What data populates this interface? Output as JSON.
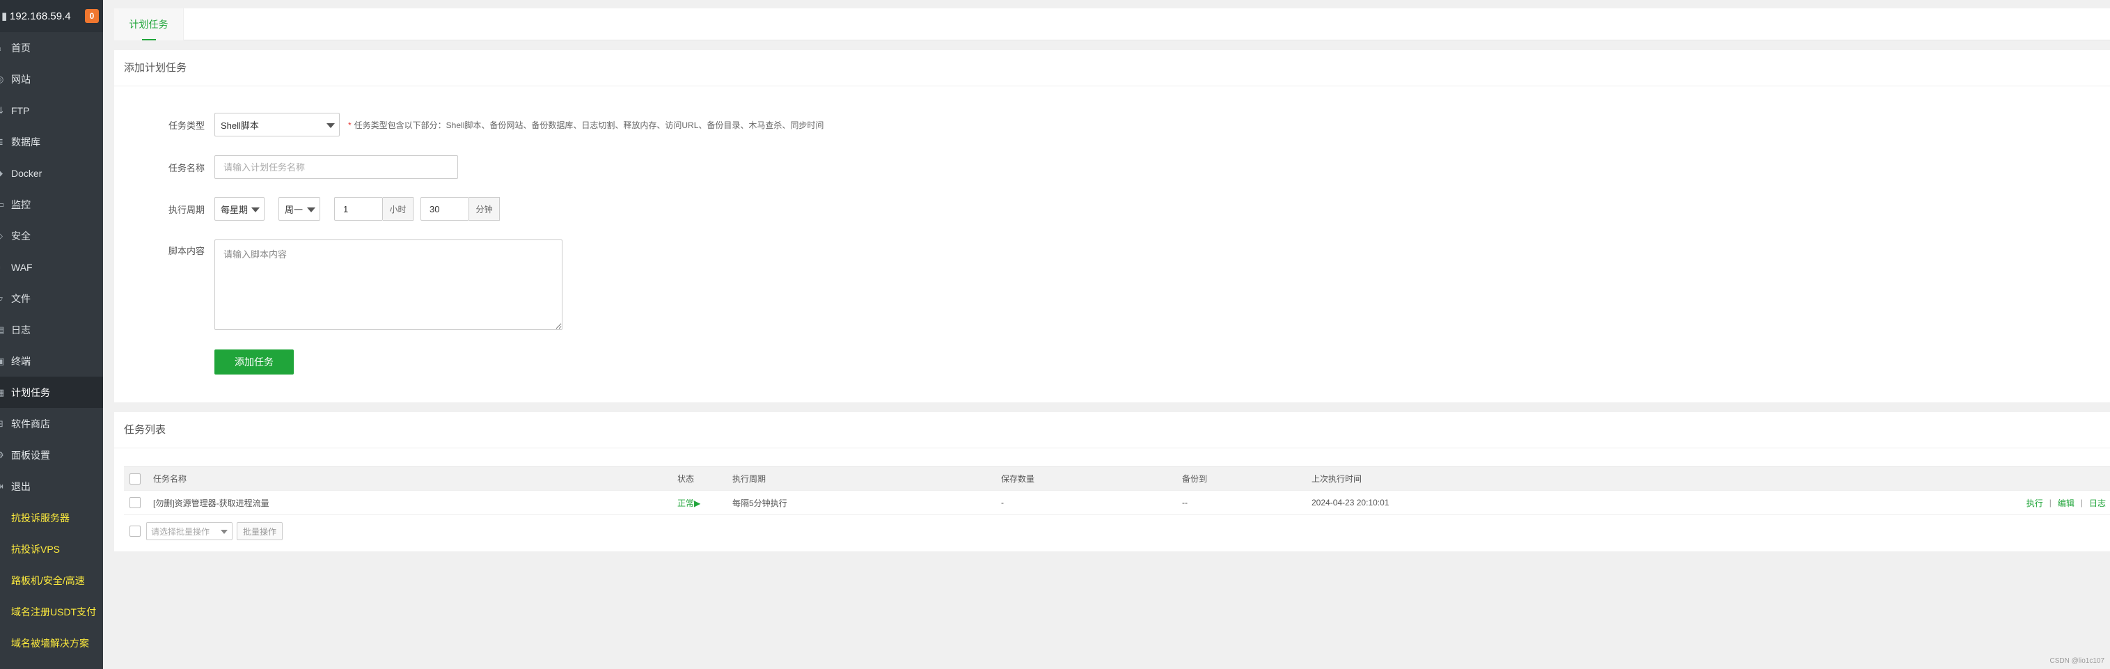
{
  "sidebar": {
    "server_ip": "192.168.59.4",
    "badge_count": "0",
    "items": [
      {
        "label": "首页",
        "icon": "home-icon",
        "glyph": "⌂"
      },
      {
        "label": "网站",
        "icon": "globe-icon",
        "glyph": "◎"
      },
      {
        "label": "FTP",
        "icon": "ftp-icon",
        "glyph": "⇅"
      },
      {
        "label": "数据库",
        "icon": "database-icon",
        "glyph": "≣"
      },
      {
        "label": "Docker",
        "icon": "docker-icon",
        "glyph": "◆"
      },
      {
        "label": "监控",
        "icon": "monitor-icon",
        "glyph": "▭"
      },
      {
        "label": "安全",
        "icon": "shield-icon",
        "glyph": "◇"
      },
      {
        "label": "WAF",
        "icon": "waf-icon",
        "glyph": "◐"
      },
      {
        "label": "文件",
        "icon": "folder-icon",
        "glyph": "▱"
      },
      {
        "label": "日志",
        "icon": "log-icon",
        "glyph": "▤"
      },
      {
        "label": "终端",
        "icon": "terminal-icon",
        "glyph": "▣"
      },
      {
        "label": "计划任务",
        "icon": "calendar-icon",
        "glyph": "▦"
      },
      {
        "label": "软件商店",
        "icon": "apps-icon",
        "glyph": "⊞"
      },
      {
        "label": "面板设置",
        "icon": "gear-icon",
        "glyph": "⚙"
      },
      {
        "label": "退出",
        "icon": "logout-icon",
        "glyph": "⇥"
      },
      {
        "label": "抗投诉服务器",
        "icon": "server-promo-icon",
        "glyph": "▪"
      },
      {
        "label": "抗投诉VPS",
        "icon": "vps-promo-icon",
        "glyph": "▪"
      },
      {
        "label": "路板机/安全/高速",
        "icon": "shield-promo-icon",
        "glyph": "▪"
      },
      {
        "label": "域名注册USDT支付",
        "icon": "domain-promo-icon",
        "glyph": "▪"
      },
      {
        "label": "域名被墙解决方案",
        "icon": "umbrella-promo-icon",
        "glyph": "▪"
      }
    ],
    "active_index": 11,
    "promo_start_index": 15,
    "colors": {
      "background": "#33393f",
      "promo": "#ffec3d",
      "badge": "#f0772f"
    }
  },
  "tabs": {
    "cron_tab": "计划任务"
  },
  "add_task": {
    "title": "添加计划任务",
    "type_label": "任务类型",
    "type_value": "Shell脚本",
    "type_hint": "任务类型包含以下部分：Shell脚本、备份网站、备份数据库、日志切割、释放内存、访问URL、备份目录、木马查杀、同步时间",
    "name_label": "任务名称",
    "name_placeholder": "请输入计划任务名称",
    "period_label": "执行周期",
    "period_type": "每星期",
    "period_weekday": "周一",
    "period_hour": "1",
    "hour_unit": "小时",
    "period_minute": "30",
    "minute_unit": "分钟",
    "script_label": "脚本内容",
    "script_placeholder": "请输入脚本内容",
    "submit_label": "添加任务",
    "accent_color": "#20a53a"
  },
  "task_list": {
    "title": "任务列表",
    "columns": [
      "任务名称",
      "状态",
      "执行周期",
      "保存数量",
      "备份到",
      "上次执行时间"
    ],
    "rows": [
      {
        "name": "[勿删]资源管理器-获取进程流量",
        "status": "正常▶",
        "period": "每隔5分钟执行",
        "save_count": "-",
        "backup_to": "--",
        "last_run": "2024-04-23 20:10:01",
        "actions": [
          "执行",
          "编辑",
          "日志"
        ]
      }
    ],
    "batch_placeholder": "请选择批量操作",
    "batch_button": "批量操作"
  },
  "footer_note": "CSDN @lio1c107"
}
